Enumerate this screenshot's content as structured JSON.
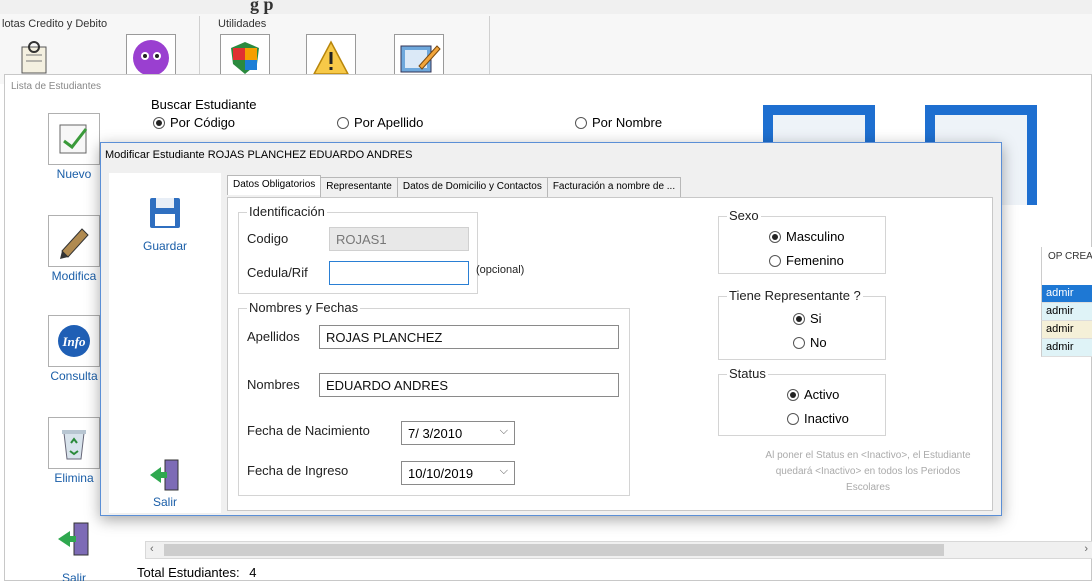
{
  "window": {
    "heading": "g    p"
  },
  "ribbon": {
    "groups": [
      {
        "label": "lotas Credito y Debito"
      },
      {
        "label": "Utilidades"
      }
    ]
  },
  "list_window": {
    "title": "Lista de Estudiantes",
    "toolbar": [
      {
        "label": "Nuevo",
        "icon": "notepad-icon"
      },
      {
        "label": "Modifica",
        "icon": "pen-icon"
      },
      {
        "label": "Consulta",
        "icon": "info-icon"
      },
      {
        "label": "Elimina",
        "icon": "recycle-bin-icon"
      },
      {
        "label": "Salir",
        "icon": "exit-door-icon"
      }
    ],
    "search": {
      "legend": "Buscar Estudiante",
      "options": [
        {
          "label": "Por Código",
          "checked": true
        },
        {
          "label": "Por Apellido",
          "checked": false
        },
        {
          "label": "Por Nombre",
          "checked": false
        }
      ]
    },
    "grid": {
      "header": "OP CREA",
      "rows": [
        "admir",
        "admir",
        "admir",
        "admir"
      ],
      "row_colors": [
        "#1e78d4",
        "#dff3f7",
        "#f5f0d8",
        "#dff3f7"
      ]
    },
    "total_label": "Total Estudiantes:",
    "total_value": "4"
  },
  "dialog": {
    "title": "Modificar Estudiante ROJAS PLANCHEZ EDUARDO ANDRES",
    "save_label": "Guardar",
    "exit_label": "Salir",
    "tabs": [
      {
        "label": "Datos Obligatorios",
        "active": true
      },
      {
        "label": "Representante",
        "active": false
      },
      {
        "label": "Datos de Domicilio y Contactos",
        "active": false
      },
      {
        "label": "Facturación a nombre de ...",
        "active": false
      }
    ],
    "identificacion": {
      "legend": "Identificación",
      "codigo_label": "Codigo",
      "codigo_value": "ROJAS1",
      "cedula_label": "Cedula/Rif",
      "cedula_value": "",
      "cedula_hint": "(opcional)"
    },
    "nombres": {
      "legend": "Nombres y Fechas",
      "apellidos_label": "Apellidos",
      "apellidos_value": "ROJAS PLANCHEZ",
      "nombres_label": "Nombres",
      "nombres_value": "EDUARDO ANDRES",
      "nacimiento_label": "Fecha de Nacimiento",
      "nacimiento_value": "7/ 3/2010",
      "ingreso_label": "Fecha de Ingreso",
      "ingreso_value": "10/10/2019"
    },
    "sexo": {
      "legend": "Sexo",
      "options": [
        {
          "label": "Masculino",
          "checked": true
        },
        {
          "label": "Femenino",
          "checked": false
        }
      ]
    },
    "representante": {
      "legend": "Tiene Representante ?",
      "options": [
        {
          "label": "Si",
          "checked": true
        },
        {
          "label": "No",
          "checked": false
        }
      ]
    },
    "status": {
      "legend": "Status",
      "options": [
        {
          "label": "Activo",
          "checked": true
        },
        {
          "label": "Inactivo",
          "checked": false
        }
      ]
    },
    "note": "Al poner el Status en <Inactivo>, el Estudiante quedará <Inactivo> en todos los Periodos Escolares"
  },
  "colors": {
    "accent": "#1e78d4",
    "link_label": "#1a5ea8",
    "dialog_border": "#5b8fd6"
  }
}
